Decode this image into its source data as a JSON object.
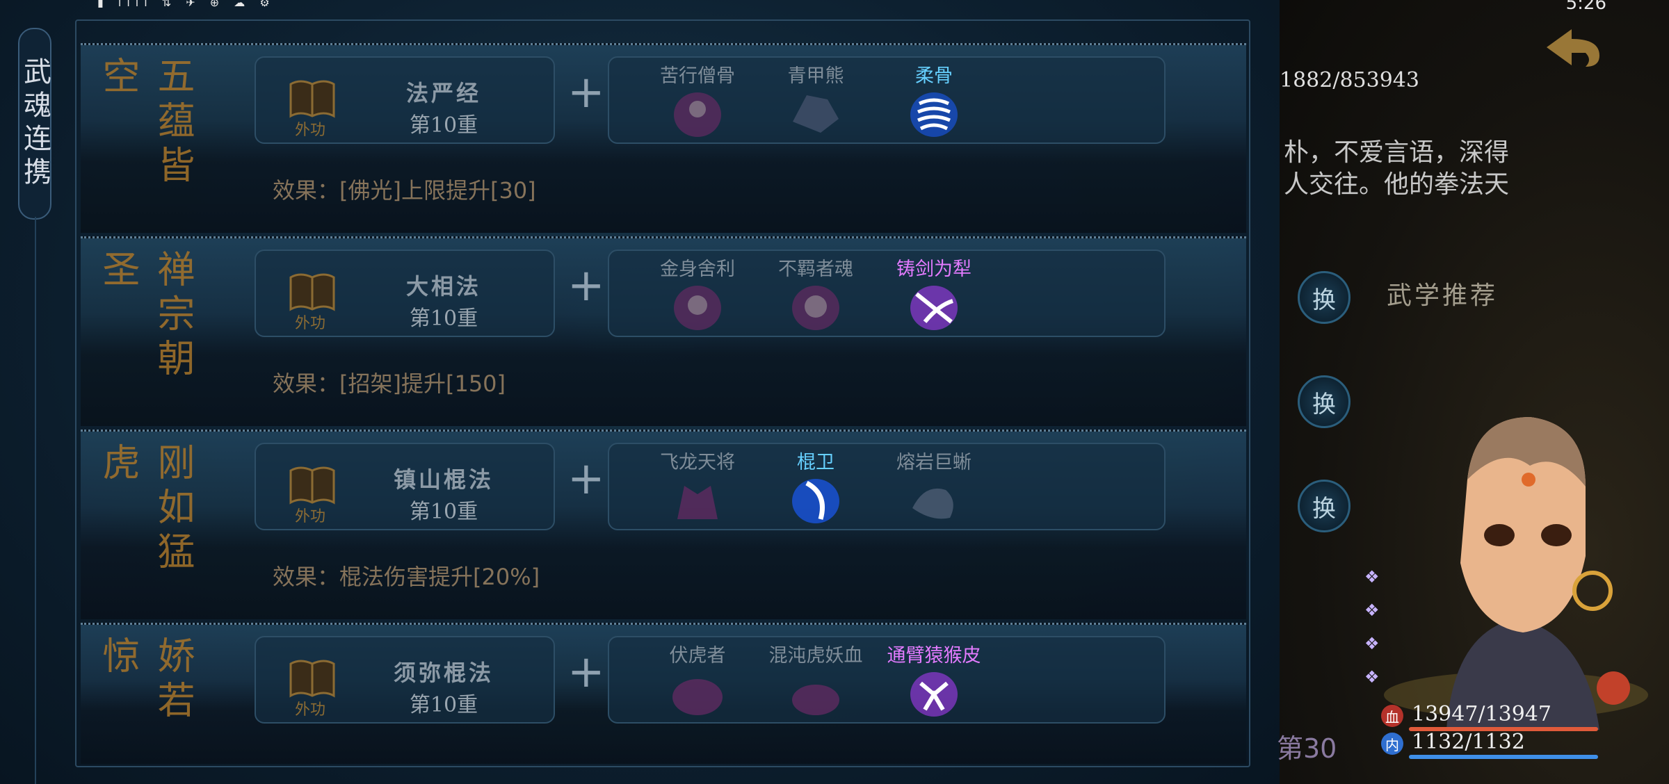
{
  "side_tab": {
    "label": "武魂连携"
  },
  "rows": [
    {
      "title": "五蕴皆空",
      "skill": {
        "name": "法严经",
        "level": "第10重",
        "type": "外功"
      },
      "souls": [
        {
          "name": "苦行僧骨",
          "state": "inactive"
        },
        {
          "name": "青甲熊",
          "state": "inactive"
        },
        {
          "name": "柔骨",
          "state": "blue"
        }
      ],
      "effect": "效果：[佛光]上限提升[30]"
    },
    {
      "title": "禅宗朝圣",
      "skill": {
        "name": "大相法",
        "level": "第10重",
        "type": "外功"
      },
      "souls": [
        {
          "name": "金身舍利",
          "state": "inactive"
        },
        {
          "name": "不羁者魂",
          "state": "inactive"
        },
        {
          "name": "铸剑为犁",
          "state": "purple"
        }
      ],
      "effect": "效果：[招架]提升[150]"
    },
    {
      "title": "刚如猛虎",
      "skill": {
        "name": "镇山棍法",
        "level": "第10重",
        "type": "外功"
      },
      "souls": [
        {
          "name": "飞龙天将",
          "state": "inactive"
        },
        {
          "name": "棍卫",
          "state": "blue"
        },
        {
          "name": "熔岩巨蜥",
          "state": "inactive"
        }
      ],
      "effect": "效果：棍法伤害提升[20%]"
    },
    {
      "title": "娇若惊",
      "skill": {
        "name": "须弥棍法",
        "level": "第10重",
        "type": "外功"
      },
      "souls": [
        {
          "name": "伏虎者",
          "state": "inactive"
        },
        {
          "name": "混沌虎妖血",
          "state": "inactive"
        },
        {
          "name": "通臂猿猴皮",
          "state": "purple"
        }
      ],
      "effect": ""
    }
  ],
  "right": {
    "count": "1882/853943",
    "desc_line1": "朴，不爱言语，深得",
    "desc_line2": "人交往。他的拳法天",
    "swap_label": "换",
    "recommend": "武学推荐",
    "level": "第30",
    "hp_badge": "血",
    "hp": "13947/13947",
    "mp_badge": "内",
    "mp": "1132/1132"
  },
  "status": {
    "time": "5:26"
  },
  "colors": {
    "gold": "#a6742a",
    "active_blue": "#66d0ff",
    "active_purple": "#e37bff",
    "hp_bar": "#e05a3a",
    "mp_bar": "#3f8fe8"
  }
}
